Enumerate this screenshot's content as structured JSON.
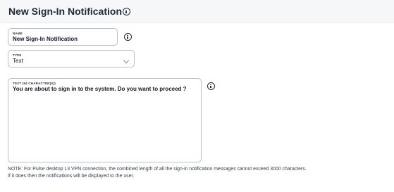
{
  "header": {
    "title": "New Sign-In Notification"
  },
  "form": {
    "name": {
      "label": "NAME",
      "value": "New Sign-In Notification"
    },
    "type": {
      "label": "TYPE",
      "value": "Text"
    },
    "text": {
      "label": "TEXT (64 CHARACTER(S))",
      "value": "You are about to sign in to the system. Do you want to proceed ?"
    }
  },
  "note": {
    "line1": "NOTE: For Pulse desktop L3 VPN connection, the combined length of all the sign-in notification messages cannot exceed 3000 characters.",
    "line2": "If it does then the notifications will be displayed to the user."
  },
  "icons": {
    "title_info": "info-icon",
    "name_info": "info-icon",
    "text_info": "info-icon",
    "type_dropdown": "chevron-down-icon"
  }
}
